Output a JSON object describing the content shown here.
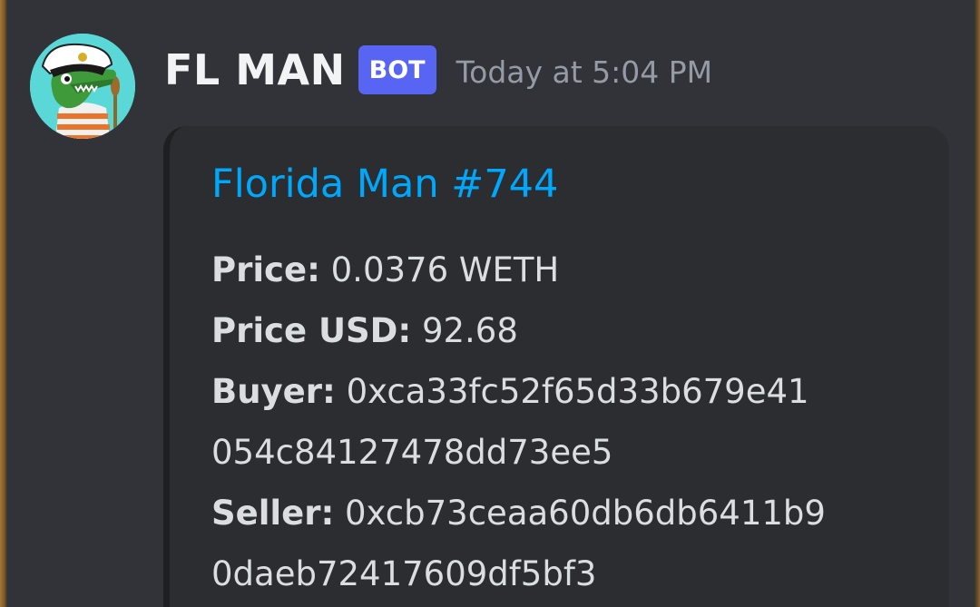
{
  "message": {
    "username": "FL MAN",
    "badge": "BOT",
    "timestamp": "Today at 5:04 PM",
    "avatar_icon": "crocodile-captain-avatar"
  },
  "embed": {
    "title": "Florida Man #744",
    "title_color": "#00a8fc",
    "fields": [
      {
        "label": "Price:",
        "value": "0.0376 WETH"
      },
      {
        "label": "Price USD:",
        "value": "92.68"
      },
      {
        "label": "Buyer:",
        "value": "0xca33fc52f65d33b679e41",
        "continuation": "054c84127478dd73ee5"
      },
      {
        "label": "Seller:",
        "value": "0xcb73ceaa60db6db6411b9",
        "continuation": "0daeb72417609df5bf3"
      }
    ]
  },
  "colors": {
    "background": "#313338",
    "embed_background": "#2b2d31",
    "badge": "#5865f2",
    "username": "#f2f3f5",
    "timestamp": "#949ba4",
    "field_text": "#dbdee1"
  }
}
